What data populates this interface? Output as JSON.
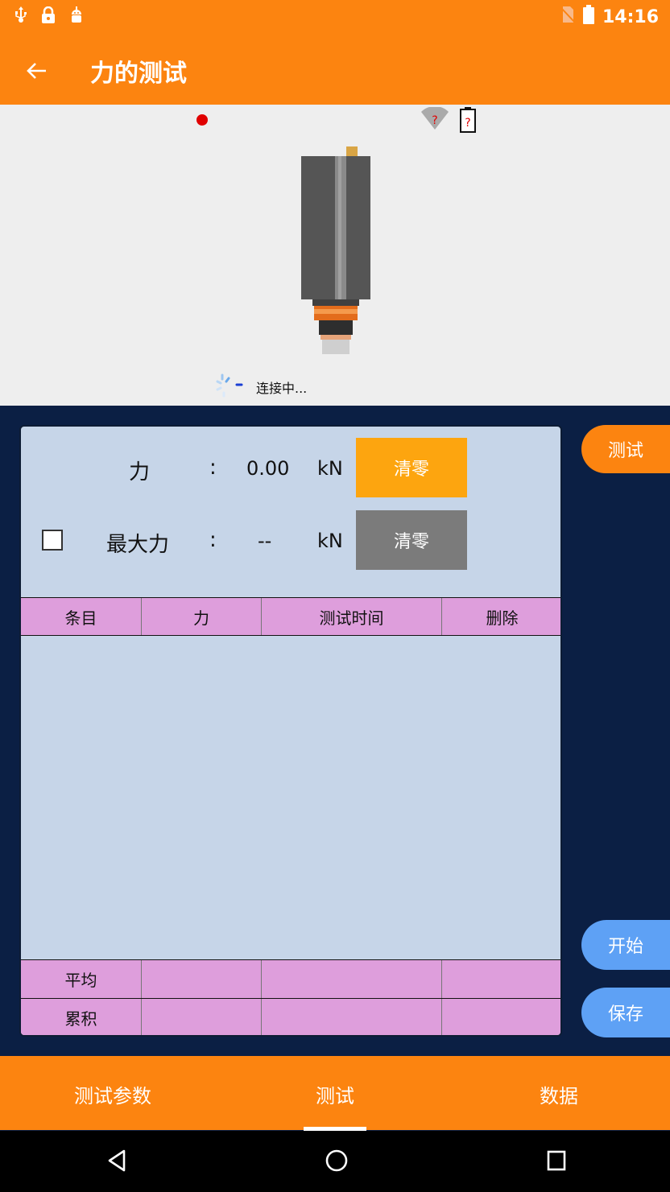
{
  "status_bar": {
    "time": "14:16",
    "icons": [
      "usb-icon",
      "lock-icon",
      "android-debug-icon",
      "no-sim-icon",
      "battery-icon"
    ]
  },
  "app_bar": {
    "back_icon": "arrow-left-icon",
    "title": "力的测试"
  },
  "device": {
    "record_indicator_color": "#e00000",
    "wifi_status": "?",
    "battery_status": "?",
    "connection_text": "连接中..."
  },
  "panel": {
    "force": {
      "label": "力",
      "colon": ":",
      "value": "0.00",
      "unit": "kN",
      "zero_button": "清零",
      "zero_button_color": "#fda50f"
    },
    "max_force": {
      "label": "最大力",
      "colon": ":",
      "value": "--",
      "unit": "kN",
      "zero_button": "清零",
      "zero_button_color": "#7b7b7b",
      "checked": false
    },
    "table": {
      "headers": [
        "条目",
        "力",
        "测试时间",
        "删除"
      ],
      "rows": [],
      "footer": [
        {
          "label": "平均"
        },
        {
          "label": "累积"
        }
      ]
    }
  },
  "side_buttons": {
    "test": "测试",
    "start": "开始",
    "save": "保存"
  },
  "bottom_tabs": [
    {
      "label": "测试参数"
    },
    {
      "label": "测试",
      "selected": true
    },
    {
      "label": "数据"
    }
  ],
  "system_nav": [
    "back-triangle-icon",
    "home-circle-icon",
    "recents-square-icon"
  ]
}
